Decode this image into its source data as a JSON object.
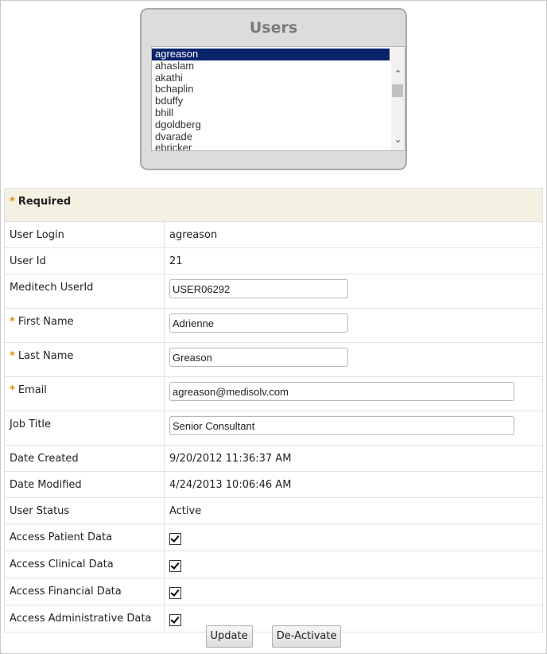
{
  "users_panel": {
    "title": "Users",
    "items": [
      "agreason",
      "ahaslam",
      "akathi",
      "bchaplin",
      "bduffy",
      "bhill",
      "dgoldberg",
      "dvarade",
      "ebricker"
    ],
    "selected": "agreason"
  },
  "form": {
    "required_label": "Required",
    "user_login": {
      "label": "User Login",
      "value": "agreason"
    },
    "user_id": {
      "label": "User Id",
      "value": "21"
    },
    "meditech_userid": {
      "label": "Meditech UserId",
      "value": "USER06292"
    },
    "first_name": {
      "label": "First Name",
      "value": "Adrienne"
    },
    "last_name": {
      "label": "Last Name",
      "value": "Greason"
    },
    "email": {
      "label": "Email",
      "value": "agreason@medisolv.com"
    },
    "job_title": {
      "label": "Job Title",
      "value": "Senior Consultant"
    },
    "date_created": {
      "label": "Date Created",
      "value": "9/20/2012 11:36:37 AM"
    },
    "date_modified": {
      "label": "Date Modified",
      "value": "4/24/2013 10:06:46 AM"
    },
    "user_status": {
      "label": "User Status",
      "value": "Active"
    },
    "access_patient": {
      "label": "Access Patient Data",
      "checked": true
    },
    "access_clinical": {
      "label": "Access Clinical Data",
      "checked": true
    },
    "access_financial": {
      "label": "Access Financial Data",
      "checked": true
    },
    "access_admin": {
      "label": "Access Administrative Data",
      "checked": true
    }
  },
  "buttons": {
    "update": "Update",
    "deactivate": "De-Activate"
  },
  "colors": {
    "required_star": "#e58a00",
    "selected_bg": "#0a246a",
    "header_bg": "#f4f1e3"
  }
}
